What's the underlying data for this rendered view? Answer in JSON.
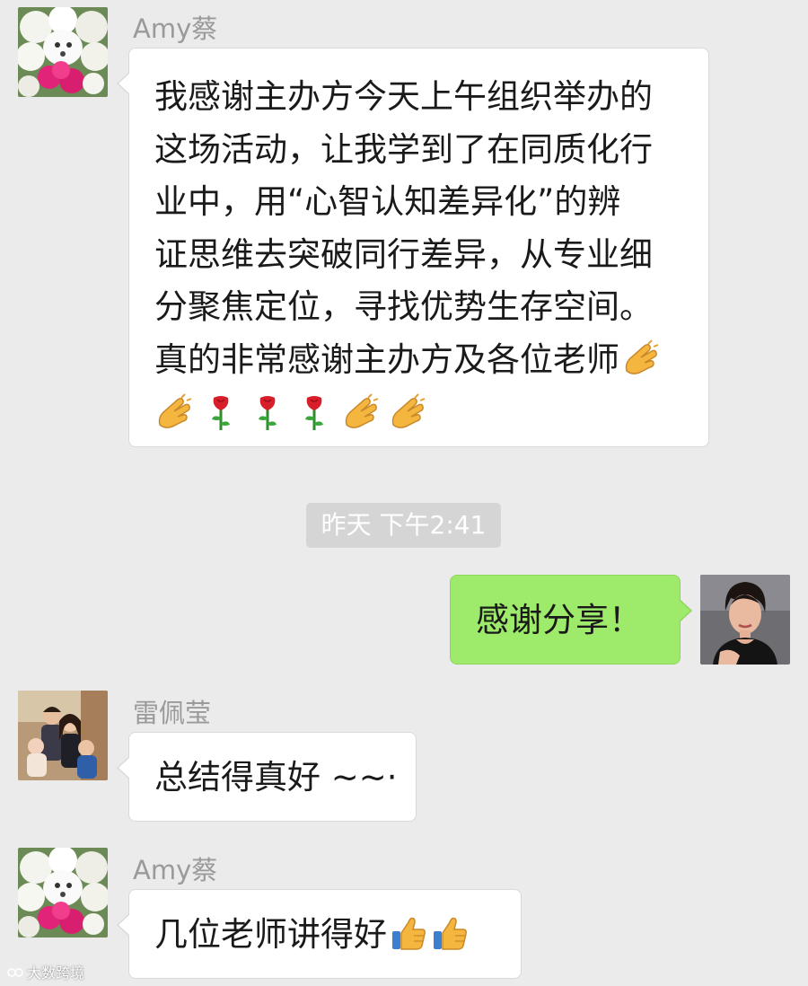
{
  "colors": {
    "background": "#ebebeb",
    "bubble_incoming": "#ffffff",
    "bubble_outgoing": "#9eea6a",
    "sender_name": "#9a9a9a",
    "timestamp_bg": "#d5d5d5"
  },
  "messages": [
    {
      "sender": "Amy蔡",
      "avatar": "flower-bouquet-avatar",
      "lines": [
        "我感谢主办方今天上午组织举办的",
        "这场活动，让我学到了在同质化行",
        "业中，用“心智认知差异化”的辨",
        "证思维去突破同行差异，从专业细",
        "分聚焦定位，寻找优势生存空间。",
        "真的非常感谢主办方及各位老师"
      ],
      "emojis": [
        "clap-hands-emoji",
        "clap-hands-emoji",
        "rose-emoji",
        "rose-emoji",
        "rose-emoji",
        "clap-hands-emoji",
        "clap-hands-emoji"
      ]
    },
    {
      "timestamp": "昨天 下午2:41"
    },
    {
      "sender": "",
      "avatar": "woman-portrait-avatar",
      "text": "感谢分享！",
      "outgoing": true
    },
    {
      "sender": "雷佩莹",
      "avatar": "family-photo-avatar",
      "text": "总结得真好 ~~·"
    },
    {
      "sender": "Amy蔡",
      "avatar": "flower-bouquet-avatar",
      "text": "几位老师讲得好",
      "emojis": [
        "thumbs-up-emoji",
        "thumbs-up-emoji"
      ]
    }
  ],
  "watermark": "大数跨境"
}
